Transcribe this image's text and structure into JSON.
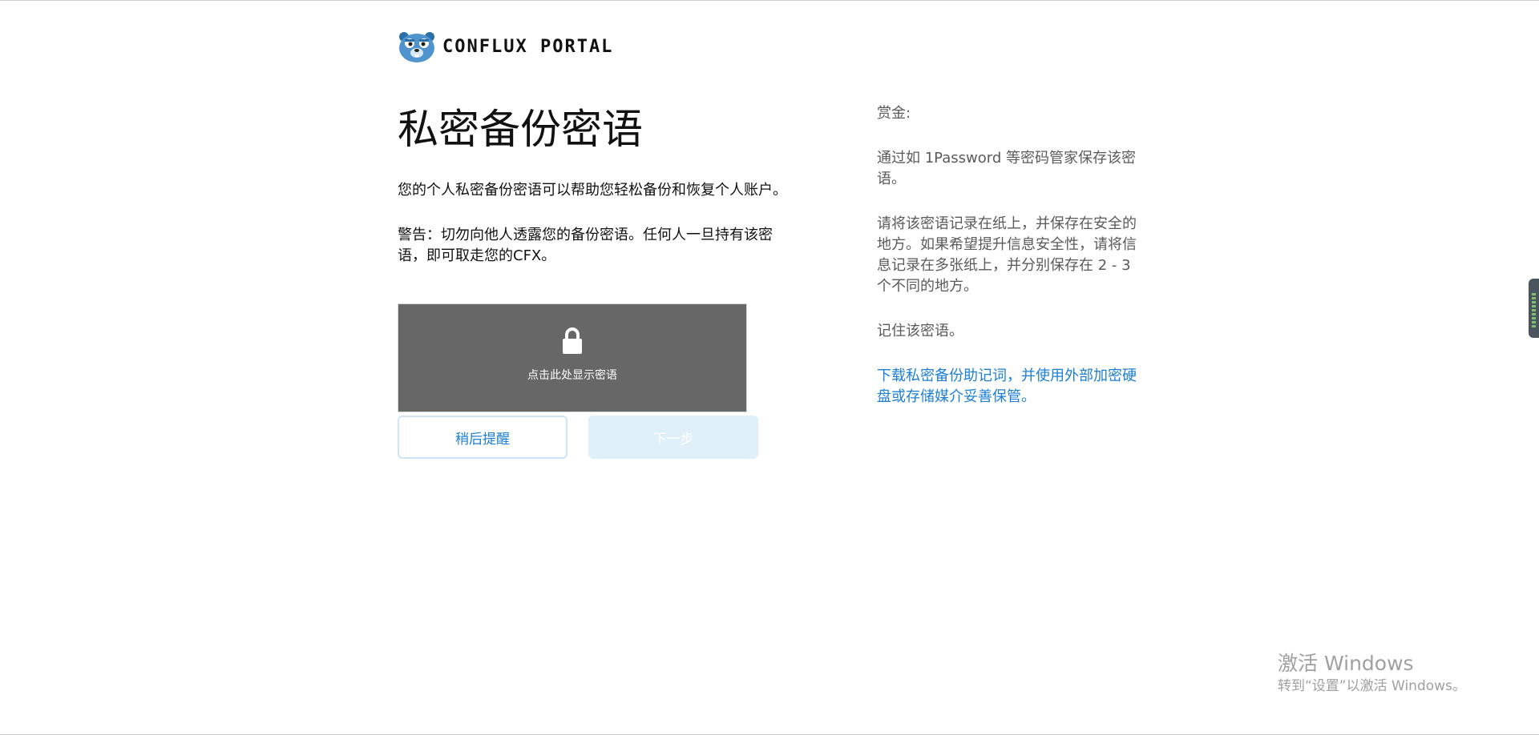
{
  "header": {
    "logo_text": "CONFLUX PORTAL",
    "mascot_icon": "bear-mascot-icon"
  },
  "main": {
    "title": "私密备份密语",
    "description": "您的个人私密备份密语可以帮助您轻松备份和恢复个人账户。",
    "warning": "警告：切勿向他人透露您的备份密语。任何人一旦持有该密语，即可取走您的CFX。",
    "secret_box": {
      "lock_icon": "lock-icon",
      "reveal_label": "点击此处显示密语",
      "background_color": "#676767"
    },
    "buttons": {
      "remind_later": "稍后提醒",
      "next": "下一步"
    }
  },
  "tips": {
    "heading": "赏金:",
    "items": [
      "通过如 1Password 等密码管家保存该密语。",
      "请将该密语记录在纸上，并保存在安全的地方。如果希望提升信息安全性，请将信息记录在多张纸上，并分别保存在 2 - 3 个不同的地方。",
      "记住该密语。"
    ],
    "download_link": "下载私密备份助记词，并使用外部加密硬盘或存储媒介妥善保管。"
  },
  "watermark": {
    "title": "激活 Windows",
    "subtitle": "转到“设置”以激活 Windows。"
  },
  "colors": {
    "accent": "#1c7fd5",
    "next_disabled_bg": "#e0f0fb",
    "secondary_text": "#5a5a5a"
  }
}
